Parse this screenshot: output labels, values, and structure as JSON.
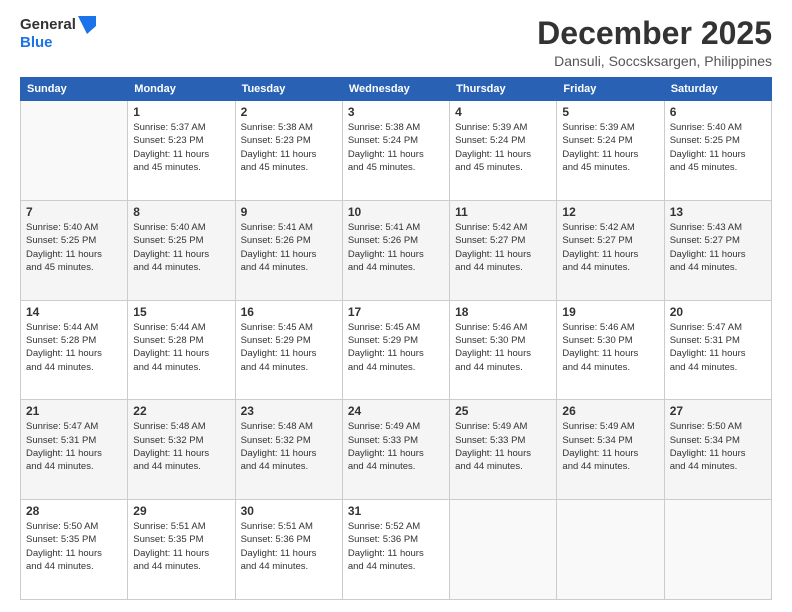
{
  "logo": {
    "line1": "General",
    "line2": "Blue"
  },
  "title": "December 2025",
  "location": "Dansuli, Soccsksargen, Philippines",
  "days_of_week": [
    "Sunday",
    "Monday",
    "Tuesday",
    "Wednesday",
    "Thursday",
    "Friday",
    "Saturday"
  ],
  "weeks": [
    [
      {
        "day": "",
        "info": ""
      },
      {
        "day": "1",
        "info": "Sunrise: 5:37 AM\nSunset: 5:23 PM\nDaylight: 11 hours\nand 45 minutes."
      },
      {
        "day": "2",
        "info": "Sunrise: 5:38 AM\nSunset: 5:23 PM\nDaylight: 11 hours\nand 45 minutes."
      },
      {
        "day": "3",
        "info": "Sunrise: 5:38 AM\nSunset: 5:24 PM\nDaylight: 11 hours\nand 45 minutes."
      },
      {
        "day": "4",
        "info": "Sunrise: 5:39 AM\nSunset: 5:24 PM\nDaylight: 11 hours\nand 45 minutes."
      },
      {
        "day": "5",
        "info": "Sunrise: 5:39 AM\nSunset: 5:24 PM\nDaylight: 11 hours\nand 45 minutes."
      },
      {
        "day": "6",
        "info": "Sunrise: 5:40 AM\nSunset: 5:25 PM\nDaylight: 11 hours\nand 45 minutes."
      }
    ],
    [
      {
        "day": "7",
        "info": "Sunrise: 5:40 AM\nSunset: 5:25 PM\nDaylight: 11 hours\nand 45 minutes."
      },
      {
        "day": "8",
        "info": "Sunrise: 5:40 AM\nSunset: 5:25 PM\nDaylight: 11 hours\nand 44 minutes."
      },
      {
        "day": "9",
        "info": "Sunrise: 5:41 AM\nSunset: 5:26 PM\nDaylight: 11 hours\nand 44 minutes."
      },
      {
        "day": "10",
        "info": "Sunrise: 5:41 AM\nSunset: 5:26 PM\nDaylight: 11 hours\nand 44 minutes."
      },
      {
        "day": "11",
        "info": "Sunrise: 5:42 AM\nSunset: 5:27 PM\nDaylight: 11 hours\nand 44 minutes."
      },
      {
        "day": "12",
        "info": "Sunrise: 5:42 AM\nSunset: 5:27 PM\nDaylight: 11 hours\nand 44 minutes."
      },
      {
        "day": "13",
        "info": "Sunrise: 5:43 AM\nSunset: 5:27 PM\nDaylight: 11 hours\nand 44 minutes."
      }
    ],
    [
      {
        "day": "14",
        "info": "Sunrise: 5:44 AM\nSunset: 5:28 PM\nDaylight: 11 hours\nand 44 minutes."
      },
      {
        "day": "15",
        "info": "Sunrise: 5:44 AM\nSunset: 5:28 PM\nDaylight: 11 hours\nand 44 minutes."
      },
      {
        "day": "16",
        "info": "Sunrise: 5:45 AM\nSunset: 5:29 PM\nDaylight: 11 hours\nand 44 minutes."
      },
      {
        "day": "17",
        "info": "Sunrise: 5:45 AM\nSunset: 5:29 PM\nDaylight: 11 hours\nand 44 minutes."
      },
      {
        "day": "18",
        "info": "Sunrise: 5:46 AM\nSunset: 5:30 PM\nDaylight: 11 hours\nand 44 minutes."
      },
      {
        "day": "19",
        "info": "Sunrise: 5:46 AM\nSunset: 5:30 PM\nDaylight: 11 hours\nand 44 minutes."
      },
      {
        "day": "20",
        "info": "Sunrise: 5:47 AM\nSunset: 5:31 PM\nDaylight: 11 hours\nand 44 minutes."
      }
    ],
    [
      {
        "day": "21",
        "info": "Sunrise: 5:47 AM\nSunset: 5:31 PM\nDaylight: 11 hours\nand 44 minutes."
      },
      {
        "day": "22",
        "info": "Sunrise: 5:48 AM\nSunset: 5:32 PM\nDaylight: 11 hours\nand 44 minutes."
      },
      {
        "day": "23",
        "info": "Sunrise: 5:48 AM\nSunset: 5:32 PM\nDaylight: 11 hours\nand 44 minutes."
      },
      {
        "day": "24",
        "info": "Sunrise: 5:49 AM\nSunset: 5:33 PM\nDaylight: 11 hours\nand 44 minutes."
      },
      {
        "day": "25",
        "info": "Sunrise: 5:49 AM\nSunset: 5:33 PM\nDaylight: 11 hours\nand 44 minutes."
      },
      {
        "day": "26",
        "info": "Sunrise: 5:49 AM\nSunset: 5:34 PM\nDaylight: 11 hours\nand 44 minutes."
      },
      {
        "day": "27",
        "info": "Sunrise: 5:50 AM\nSunset: 5:34 PM\nDaylight: 11 hours\nand 44 minutes."
      }
    ],
    [
      {
        "day": "28",
        "info": "Sunrise: 5:50 AM\nSunset: 5:35 PM\nDaylight: 11 hours\nand 44 minutes."
      },
      {
        "day": "29",
        "info": "Sunrise: 5:51 AM\nSunset: 5:35 PM\nDaylight: 11 hours\nand 44 minutes."
      },
      {
        "day": "30",
        "info": "Sunrise: 5:51 AM\nSunset: 5:36 PM\nDaylight: 11 hours\nand 44 minutes."
      },
      {
        "day": "31",
        "info": "Sunrise: 5:52 AM\nSunset: 5:36 PM\nDaylight: 11 hours\nand 44 minutes."
      },
      {
        "day": "",
        "info": ""
      },
      {
        "day": "",
        "info": ""
      },
      {
        "day": "",
        "info": ""
      }
    ]
  ]
}
